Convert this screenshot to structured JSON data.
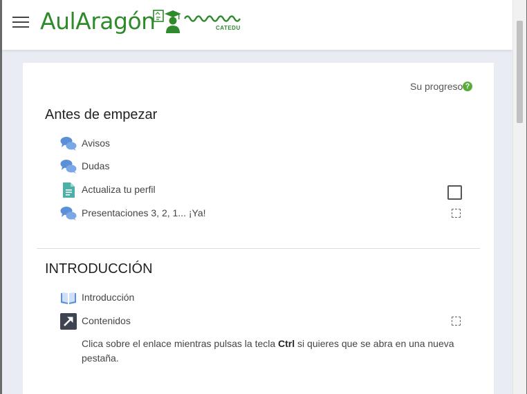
{
  "header": {
    "logo_text": "AulAragón",
    "logo_subtext": "CATEDU",
    "menu_icon": "hamburger-icon"
  },
  "course": {
    "progress_label": "Su progreso",
    "sections": [
      {
        "title": "Antes de empezar",
        "activities": [
          {
            "label": "Avisos",
            "icon": "forum-icon",
            "completion": "none"
          },
          {
            "label": "Dudas",
            "icon": "forum-icon",
            "completion": "none"
          },
          {
            "label": "Actualiza tu perfil",
            "icon": "page-icon",
            "completion": "manual"
          },
          {
            "label": "Presentaciones 3, 2, 1... ¡Ya!",
            "icon": "forum-icon",
            "completion": "automatic"
          }
        ]
      },
      {
        "title": "INTRODUCCIÓN",
        "activities": [
          {
            "label": "Introducción",
            "icon": "book-icon",
            "completion": "none"
          },
          {
            "label": "Contenidos",
            "icon": "url-icon",
            "completion": "automatic"
          }
        ],
        "description_before": "Clica sobre el enlace mientras pulsas la tecla ",
        "description_key": "Ctrl",
        "description_after": " si quieres que se abra en una nueva pestaña."
      }
    ]
  },
  "colors": {
    "brand_green": "#2f8a2c",
    "icon_blue": "#5b8fd6",
    "page_teal": "#4bb1a6",
    "progress_green": "#5aaa3c"
  }
}
